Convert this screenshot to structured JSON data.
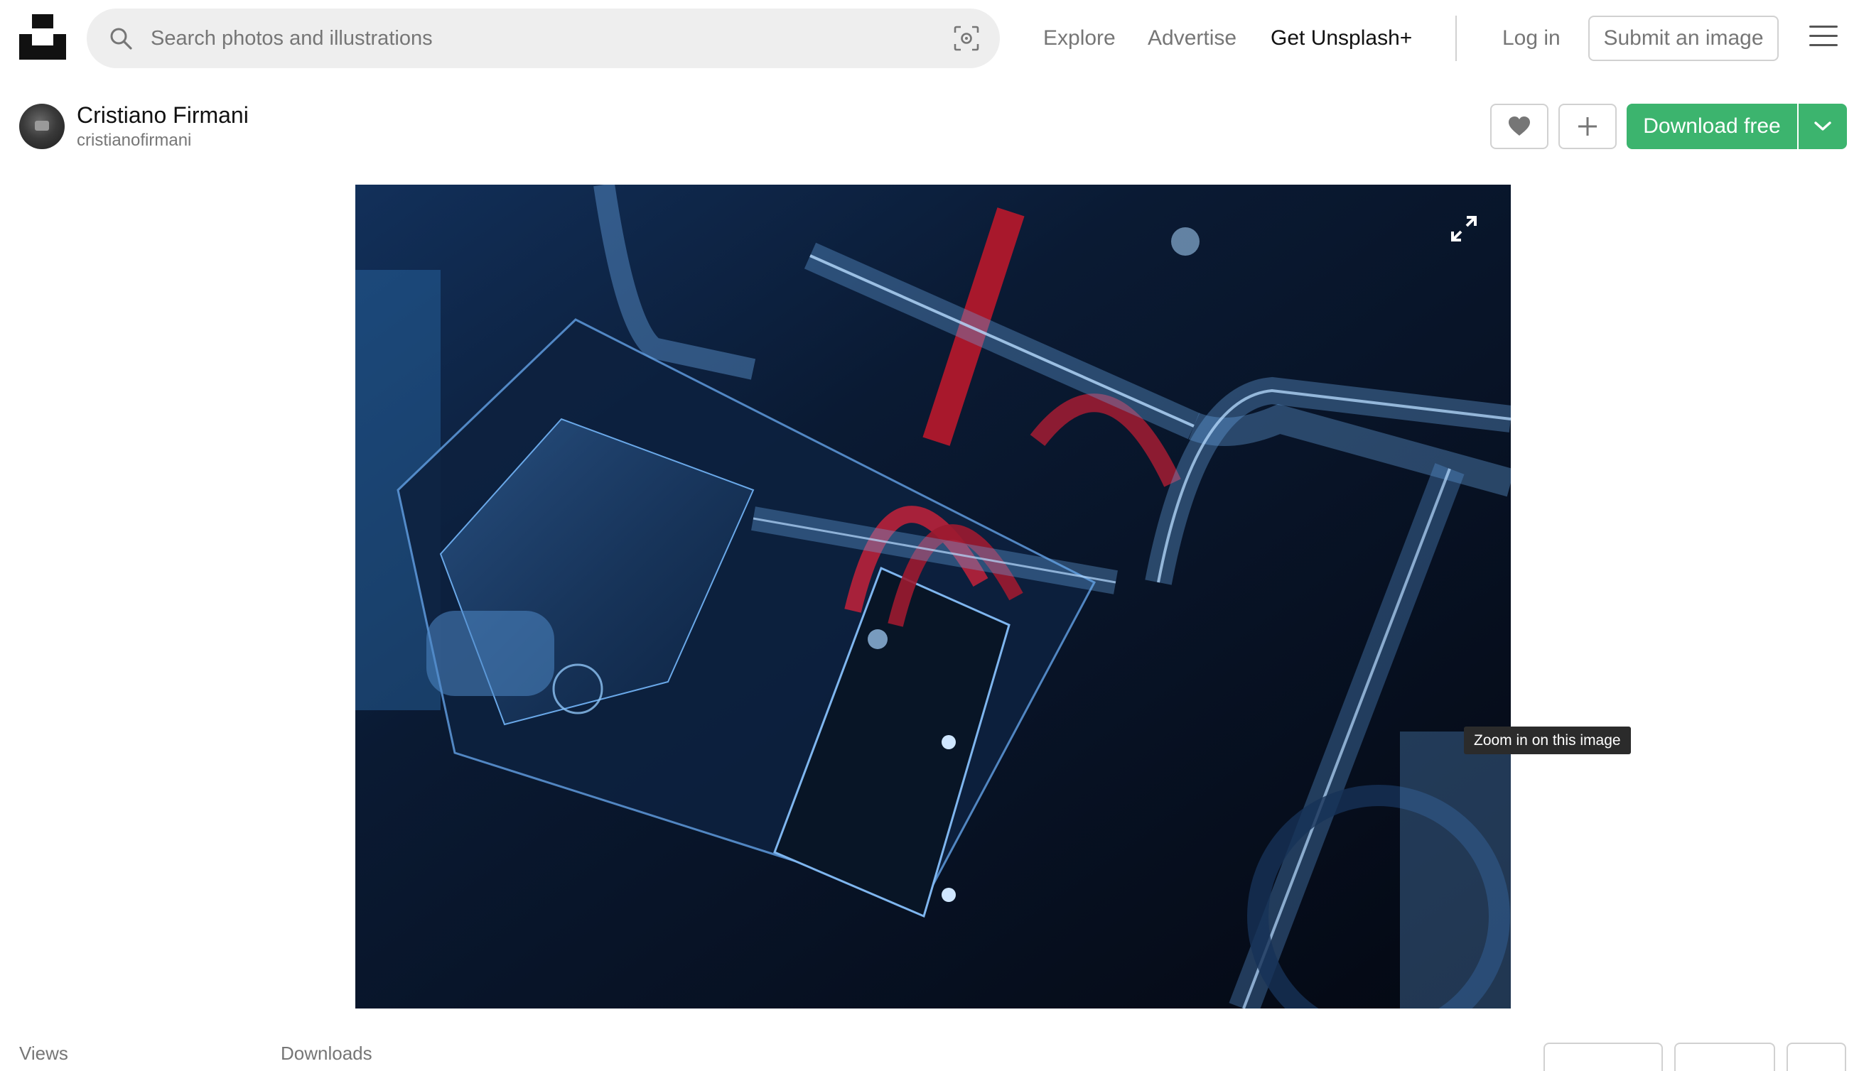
{
  "header": {
    "search_placeholder": "Search photos and illustrations",
    "nav": {
      "explore": "Explore",
      "advertise": "Advertise",
      "get_plus": "Get Unsplash+",
      "login": "Log in",
      "submit": "Submit an image"
    }
  },
  "author": {
    "name": "Cristiano Firmani",
    "handle": "cristianofirmani"
  },
  "actions": {
    "download_label": "Download free"
  },
  "photo": {
    "tooltip": "Zoom in on this image"
  },
  "stats": {
    "views_label": "Views",
    "downloads_label": "Downloads"
  },
  "colors": {
    "accent_green": "#3cb46e",
    "text_muted": "#767676",
    "border": "#d1d1d1"
  }
}
